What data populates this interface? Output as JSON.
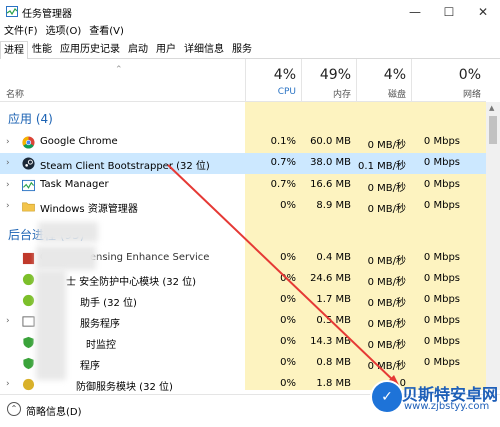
{
  "window": {
    "title": "任务管理器",
    "minimize": "—",
    "maximize": "☐",
    "close": "✕"
  },
  "menu": [
    "文件(F)",
    "选项(O)",
    "查看(V)"
  ],
  "tabs": [
    "进程",
    "性能",
    "应用历史记录",
    "启动",
    "用户",
    "详细信息",
    "服务"
  ],
  "header": {
    "name_col": "名称",
    "cpu": {
      "pct": "4%",
      "label": "CPU"
    },
    "memory": {
      "pct": "49%",
      "label": "内存"
    },
    "disk": {
      "pct": "4%",
      "label": "磁盘"
    },
    "network": {
      "pct": "0%",
      "label": "网络"
    }
  },
  "sections": {
    "apps": "应用 (4)",
    "background": "后台进程 (95)"
  },
  "apps": [
    {
      "name": "Google Chrome",
      "cpu": "0.1%",
      "mem": "60.0 MB",
      "disk": "0 MB/秒",
      "net": "0 Mbps",
      "icon": "chrome-icon"
    },
    {
      "name": "Steam Client Bootstrapper (32 位)",
      "cpu": "0.7%",
      "mem": "38.0 MB",
      "disk": "0.1 MB/秒",
      "net": "0 Mbps",
      "icon": "steam-icon"
    },
    {
      "name": "Task Manager",
      "cpu": "0.7%",
      "mem": "16.6 MB",
      "disk": "0 MB/秒",
      "net": "0 Mbps",
      "icon": "task-manager-icon"
    },
    {
      "name": "Windows 资源管理器",
      "cpu": "0%",
      "mem": "8.9 MB",
      "disk": "0 MB/秒",
      "net": "0 Mbps",
      "icon": "folder-icon"
    }
  ],
  "background": [
    {
      "name": "Offline Licensing Enhance Service",
      "cpu": "0%",
      "mem": "0.4 MB",
      "disk": "0 MB/秒",
      "net": "0 Mbps"
    },
    {
      "name": "士 安全防护中心模块 (32 位)",
      "cpu": "0%",
      "mem": "24.6 MB",
      "disk": "0 MB/秒",
      "net": "0 Mbps"
    },
    {
      "name": "助手 (32 位)",
      "cpu": "0%",
      "mem": "1.7 MB",
      "disk": "0 MB/秒",
      "net": "0 Mbps"
    },
    {
      "name": "服务程序",
      "cpu": "0%",
      "mem": "0.5 MB",
      "disk": "0 MB/秒",
      "net": "0 Mbps"
    },
    {
      "name": "时监控",
      "cpu": "0%",
      "mem": "14.3 MB",
      "disk": "0 MB/秒",
      "net": "0 Mbps"
    },
    {
      "name": "程序",
      "cpu": "0%",
      "mem": "0.8 MB",
      "disk": "0 MB/秒",
      "net": "0 Mbps"
    },
    {
      "name": "防御服务模块 (32 位)",
      "cpu": "0%",
      "mem": "1.8 MB",
      "disk": "0",
      "net": ""
    }
  ],
  "footer": {
    "fewer_details": "简略信息(D)"
  },
  "watermark": {
    "title": "贝斯特安卓网",
    "url": "www.zjbstyy.com"
  }
}
